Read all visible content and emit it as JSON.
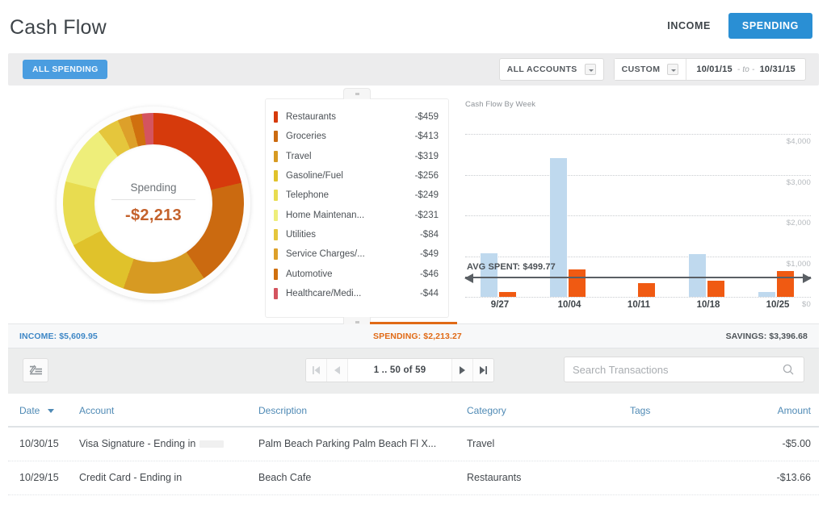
{
  "header": {
    "title": "Cash Flow",
    "tab_income": "INCOME",
    "tab_spending": "SPENDING"
  },
  "filters": {
    "all_spending_pill": "ALL SPENDING",
    "accounts_select": "ALL ACCOUNTS",
    "range_select": "CUSTOM",
    "date_from": "10/01/15",
    "date_sep": "- to -",
    "date_to": "10/31/15"
  },
  "donut": {
    "center_label": "Spending",
    "center_value": "-$2,213"
  },
  "legend": [
    {
      "name": "Restaurants",
      "amount": "-$459",
      "color": "#d63a0c"
    },
    {
      "name": "Groceries",
      "amount": "-$413",
      "color": "#cb6a10"
    },
    {
      "name": "Travel",
      "amount": "-$319",
      "color": "#d79a22"
    },
    {
      "name": "Gasoline/Fuel",
      "amount": "-$256",
      "color": "#e0c22b"
    },
    {
      "name": "Telephone",
      "amount": "-$249",
      "color": "#e8dc50"
    },
    {
      "name": "Home Maintenan...",
      "amount": "-$231",
      "color": "#eeee7a"
    },
    {
      "name": "Utilities",
      "amount": "-$84",
      "color": "#e5c63c"
    },
    {
      "name": "Service Charges/...",
      "amount": "-$49",
      "color": "#dda02a"
    },
    {
      "name": "Automotive",
      "amount": "-$46",
      "color": "#d0700f"
    },
    {
      "name": "Healthcare/Medi...",
      "amount": "-$44",
      "color": "#d4545f"
    }
  ],
  "chart_data": {
    "type": "bar",
    "title": "Cash Flow By Week",
    "xlabel": "",
    "ylabel": "",
    "ylim": [
      0,
      4400
    ],
    "grid": true,
    "gridlines": [
      0,
      1000,
      2000,
      3000,
      4000
    ],
    "tick_labels": [
      "$0",
      "$1,000",
      "$2,000",
      "$3,000",
      "$4,000"
    ],
    "categories": [
      "9/27",
      "10/04",
      "10/11",
      "10/18",
      "10/25"
    ],
    "series": [
      {
        "name": "Income",
        "color": "#bfd9ee",
        "values": [
          1070,
          3410,
          0,
          1060,
          110
        ]
      },
      {
        "name": "Spending",
        "color": "#f05a12",
        "values": [
          110,
          680,
          330,
          390,
          640
        ]
      }
    ],
    "annotation": {
      "label": "AVG SPENT: $499.77",
      "value": 499.77
    }
  },
  "summary": {
    "income": "INCOME: $5,609.95",
    "spending": "SPENDING: $2,213.27",
    "savings": "SAVINGS: $3,396.68"
  },
  "toolbar": {
    "edit_icon": "edit-list-icon",
    "page_label": "1 .. 50 of 59",
    "first_icon": "first-page-icon",
    "prev_icon": "prev-page-icon",
    "next_icon": "next-page-icon",
    "last_icon": "last-page-icon",
    "search_placeholder": "Search Transactions",
    "search_value": ""
  },
  "table": {
    "columns": [
      "Date",
      "Account",
      "Description",
      "Category",
      "Tags",
      "Amount"
    ],
    "rows": [
      {
        "date": "10/30/15",
        "account": "Visa Signature - Ending in",
        "account_redacted": true,
        "description": "Palm Beach Parking Palm Beach Fl X...",
        "category": "Travel",
        "tags": "",
        "amount": "-$5.00"
      },
      {
        "date": "10/29/15",
        "account": "Credit Card - Ending in",
        "account_redacted": false,
        "description": "Beach Cafe",
        "category": "Restaurants",
        "tags": "",
        "amount": "-$13.66"
      }
    ]
  }
}
